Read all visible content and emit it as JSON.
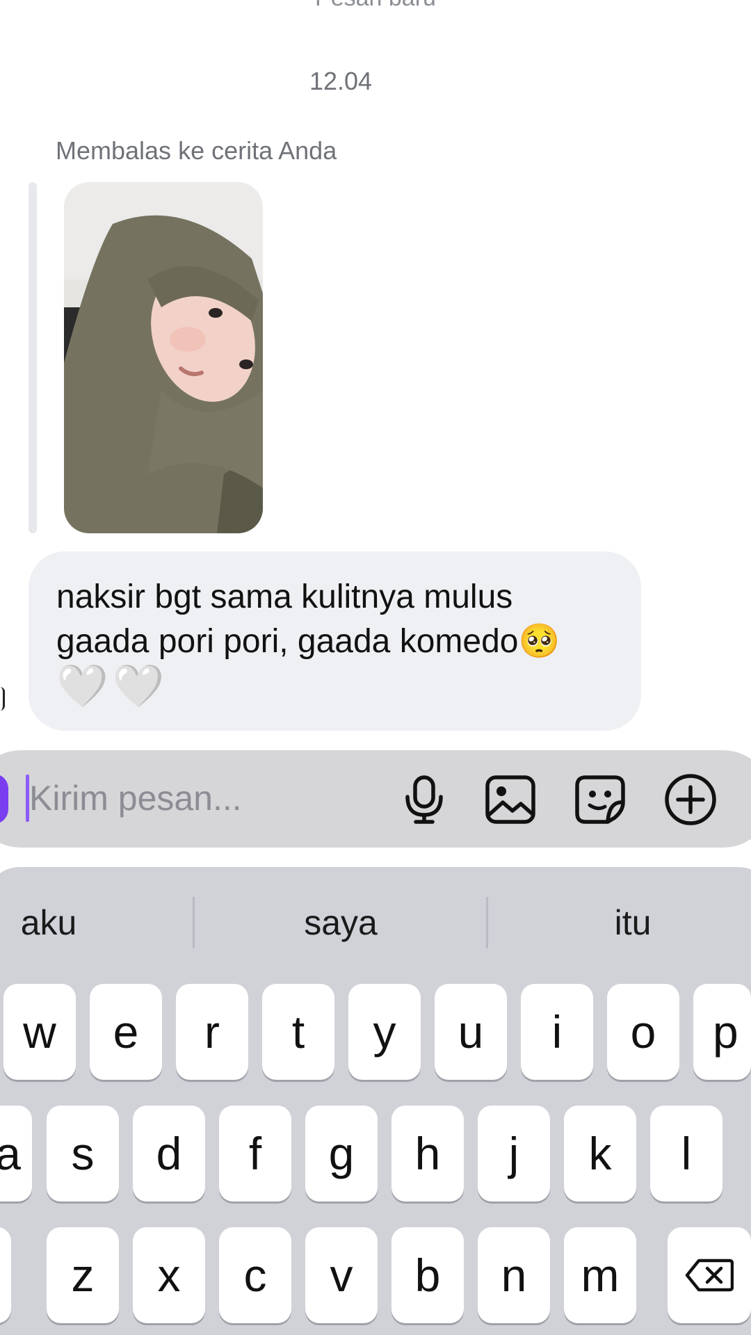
{
  "thread": {
    "new_messages_banner": "Pesan baru",
    "timestamp": "12.04",
    "reply_caption": "Membalas ke cerita Anda"
  },
  "message": {
    "line1": "naksir bgt sama kulitnya mulus",
    "line2": "gaada pori pori, gaada komedo",
    "pleading_emoji": "🥺",
    "hearts": "🤍🤍"
  },
  "composer": {
    "placeholder": "Kirim pesan...",
    "value": ""
  },
  "icons": {
    "composer": [
      "microphone-icon",
      "image-icon",
      "sticker-icon",
      "plus-circle-icon"
    ],
    "keyboard": [
      "backspace-icon"
    ]
  },
  "keyboard": {
    "suggestions": [
      "aku",
      "saya",
      "itu"
    ],
    "row1": [
      "w",
      "e",
      "r",
      "t",
      "y",
      "u",
      "i",
      "o",
      "p"
    ],
    "row2": [
      "a",
      "s",
      "d",
      "f",
      "g",
      "h",
      "j",
      "k",
      "l"
    ],
    "row3": [
      "z",
      "x",
      "c",
      "v",
      "b",
      "n",
      "m"
    ]
  },
  "colors": {
    "accent": "#8b5cf6",
    "bubble": "#eff0f3",
    "composer": "#d6d6d8",
    "keyboard": "#d0d2d8"
  }
}
